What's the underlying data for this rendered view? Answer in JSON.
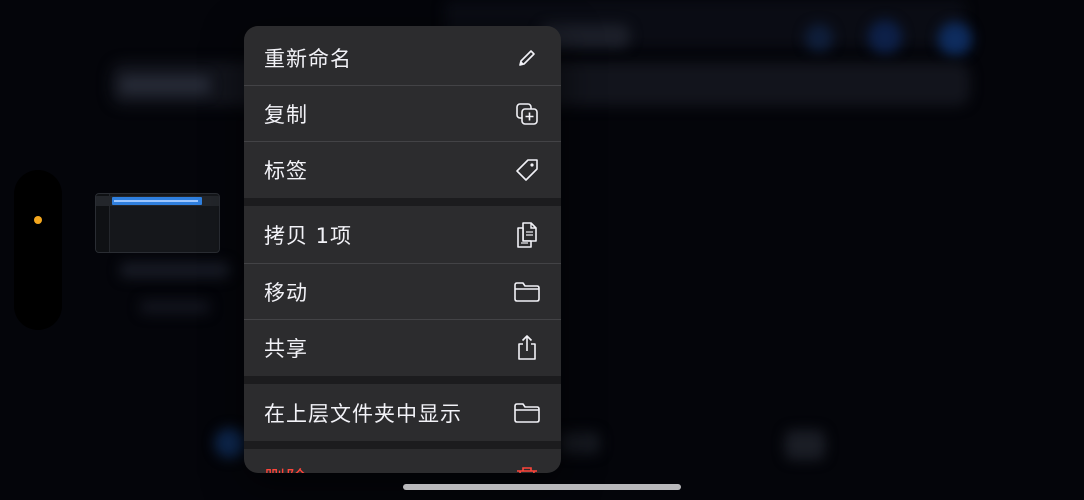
{
  "menu": {
    "items": [
      {
        "label": "重新命名",
        "icon": "pencil-icon"
      },
      {
        "label": "复制",
        "icon": "duplicate-icon"
      },
      {
        "label": "标签",
        "icon": "tag-icon"
      },
      {
        "label": "拷贝 1项",
        "icon": "copy-document-icon"
      },
      {
        "label": "移动",
        "icon": "folder-icon"
      },
      {
        "label": "共享",
        "icon": "share-icon"
      },
      {
        "label": "在上层文件夹中显示",
        "icon": "folder-icon"
      },
      {
        "label": "删除",
        "icon": "trash-icon"
      }
    ]
  },
  "colors": {
    "menu_background": "#2c2c2e",
    "menu_text": "#f2f2f7",
    "destructive": "#ff453a",
    "status_dot": "#f4a71e",
    "selection": "#2f7fde"
  }
}
